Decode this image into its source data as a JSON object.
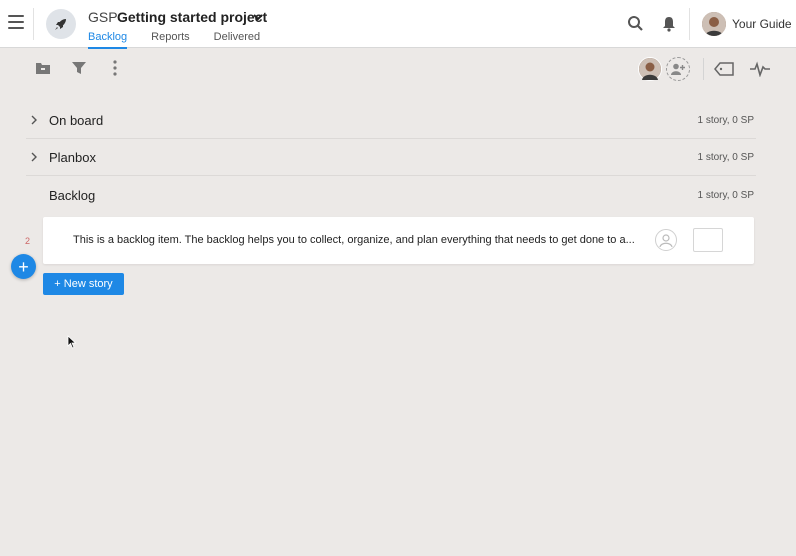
{
  "header": {
    "project_key": "GSP",
    "project_name": "Getting started project",
    "tabs": [
      {
        "label": "Backlog",
        "active": true
      },
      {
        "label": "Reports",
        "active": false
      },
      {
        "label": "Delivered",
        "active": false
      }
    ],
    "user_name": "Your Guide"
  },
  "icons": {
    "menu": "hamburger-menu-icon",
    "project_logo": "rocket-icon",
    "search": "search-icon",
    "notifications": "bell-icon",
    "toolbar": [
      "folder-icon",
      "filter-icon",
      "more-vertical-icon",
      "add-user-icon",
      "tag-icon",
      "pulse-icon"
    ]
  },
  "groups": [
    {
      "name": "On board",
      "count": "1 story, 0 SP",
      "expandable": true
    },
    {
      "name": "Planbox",
      "count": "1 story, 0 SP",
      "expandable": true
    },
    {
      "name": "Backlog",
      "count": "1 story, 0 SP",
      "expandable": false
    }
  ],
  "story": {
    "number": "2",
    "text": "This is a backlog item. The backlog helps you to collect, organize, and plan everything that needs to get done to a..."
  },
  "actions": {
    "fab_label": "+",
    "new_story_label": "+ New story"
  },
  "colors": {
    "accent": "#1e88e5",
    "background": "#ece9e7",
    "story_number": "#cc6666"
  }
}
